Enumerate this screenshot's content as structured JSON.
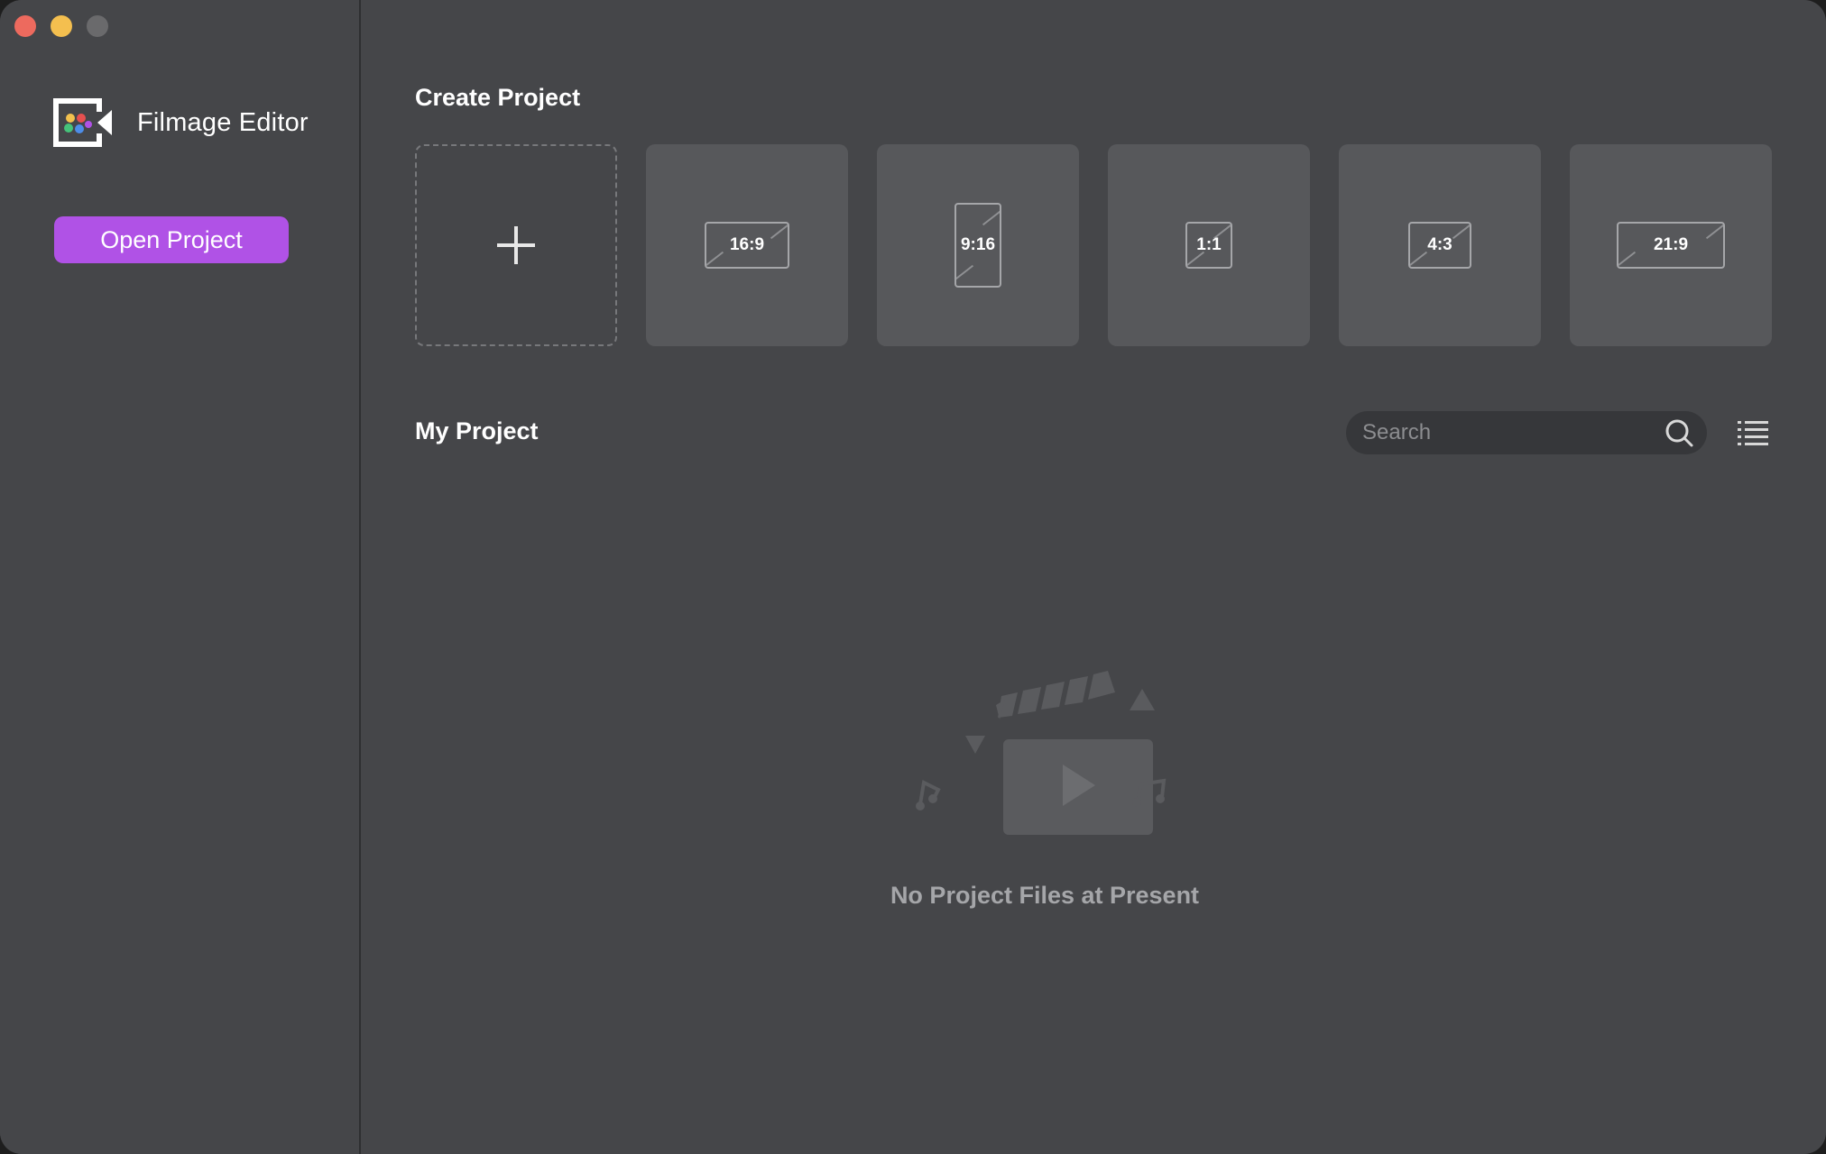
{
  "window": {
    "controls": [
      "close",
      "minimize",
      "zoom"
    ]
  },
  "sidebar": {
    "app_name": "Filmage Editor",
    "open_project_label": "Open Project"
  },
  "create_project": {
    "title": "Create Project",
    "new_tile_icon": "plus-icon",
    "ratios": [
      "16:9",
      "9:16",
      "1:1",
      "4:3",
      "21:9"
    ]
  },
  "my_project": {
    "title": "My Project",
    "search_placeholder": "Search",
    "empty_message": "No Project Files at Present"
  },
  "colors": {
    "background": "#454649",
    "tile": "#57585b",
    "accent": "#b052e6",
    "search_bg": "#36373a"
  }
}
